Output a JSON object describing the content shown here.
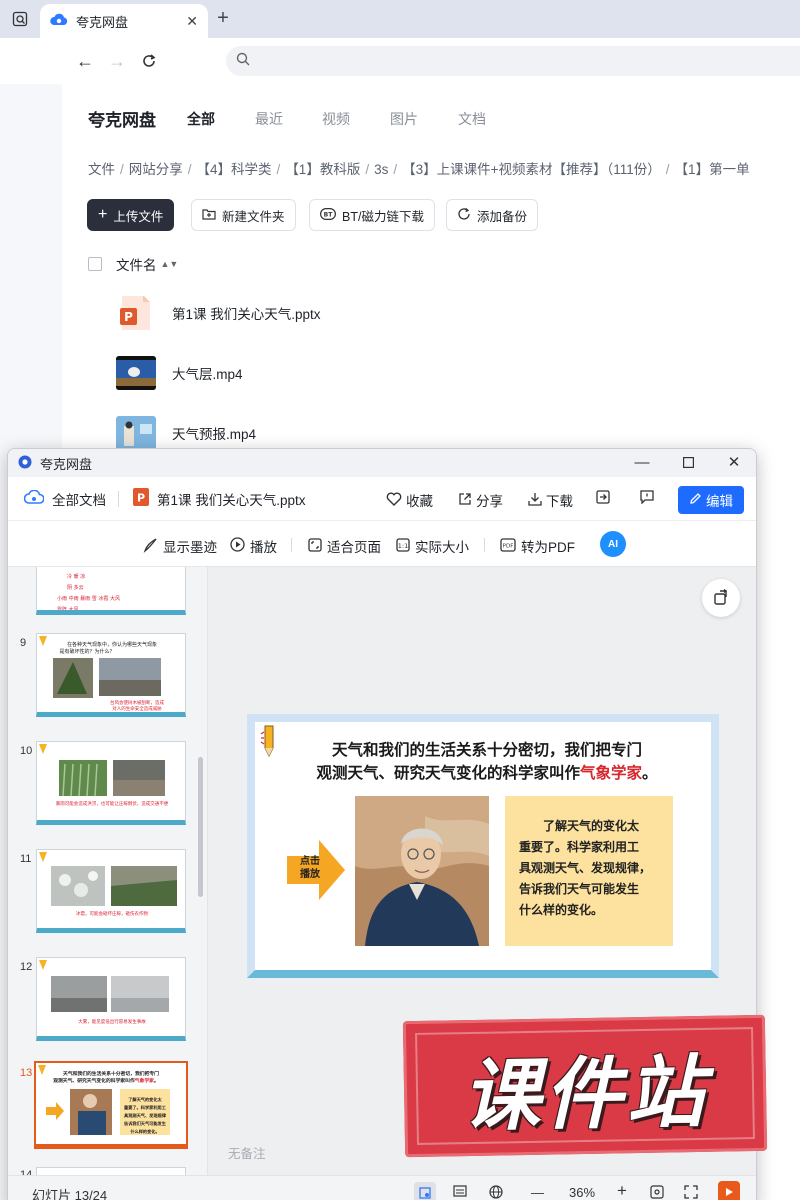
{
  "browser": {
    "tab_title": "夸克网盘",
    "tab_close": "✕",
    "new_tab": "+"
  },
  "page": {
    "brand": "夸克网盘",
    "tabs": [
      "全部",
      "最近",
      "视频",
      "图片",
      "文档"
    ],
    "breadcrumb": [
      "文件",
      "网站分享",
      "【4】科学类",
      "【1】教科版",
      "3s",
      "【3】上课课件+视频素材【推荐】（111份）",
      "【1】第一单"
    ],
    "toolbar": {
      "upload": "上传文件",
      "new_folder": "新建文件夹",
      "bt_download": "BT/磁力链下载",
      "add_backup": "添加备份"
    },
    "column_header": "文件名",
    "files": [
      {
        "name": "第1课 我们关心天气.pptx"
      },
      {
        "name": "大气层.mp4"
      },
      {
        "name": "天气预报.mp4"
      }
    ]
  },
  "viewer": {
    "window_title": "夸克网盘",
    "all_docs": "全部文档",
    "doc_name": "第1课 我们关心天气.pptx",
    "actions": {
      "favorite": "收藏",
      "share": "分享",
      "download": "下载",
      "edit": "编辑"
    },
    "tools": {
      "show_ink": "显示墨迹",
      "play": "播放",
      "fit_page": "适合页面",
      "actual_size": "实际大小",
      "to_pdf": "转为PDF",
      "ai": "AI"
    },
    "thumbnails": [
      {
        "num": "9",
        "caption": "在各种天气现象中，你认为哪些天气现象是有破坏性的？为什么？"
      },
      {
        "num": "10",
        "caption": "暴雨可能会造成洪涝，也可能让庄稼倒伏，造成交通不便"
      },
      {
        "num": "11",
        "caption": "冰雹，可能会砸坏庄稼，砸伤农作物"
      },
      {
        "num": "12",
        "caption": "大雾，能见度低出行容易发生事故"
      },
      {
        "num": "13",
        "caption": "天气和我们的生活关系十分密切"
      },
      {
        "num": "14",
        "caption": ""
      }
    ],
    "slide": {
      "title_line1": "天气和我们的生活关系十分密切，我们把专门",
      "title_line2_pre": "观测天气、研究天气变化的科学家叫作",
      "title_highlight": "气象学家",
      "title_line2_post": "。",
      "arrow_label_1": "点击",
      "arrow_label_2": "播放",
      "box_text": [
        "了解天气的变化太",
        "重要了。科学家利用工",
        "具观测天气、发现规律，",
        "告诉我们天气可能发生",
        "什么样的变化。"
      ]
    },
    "notes_placeholder": "无备注",
    "status": {
      "slide_counter": "幻灯片 13/24",
      "zoom": "36%",
      "zoom_out": "—",
      "zoom_in": "+"
    }
  },
  "watermark": "课件站",
  "colors": {
    "edit_blue": "#1e6bff",
    "active_orange": "#e35a1c",
    "highlight_red": "#d8262c",
    "stamp_red": "#d93a45"
  }
}
